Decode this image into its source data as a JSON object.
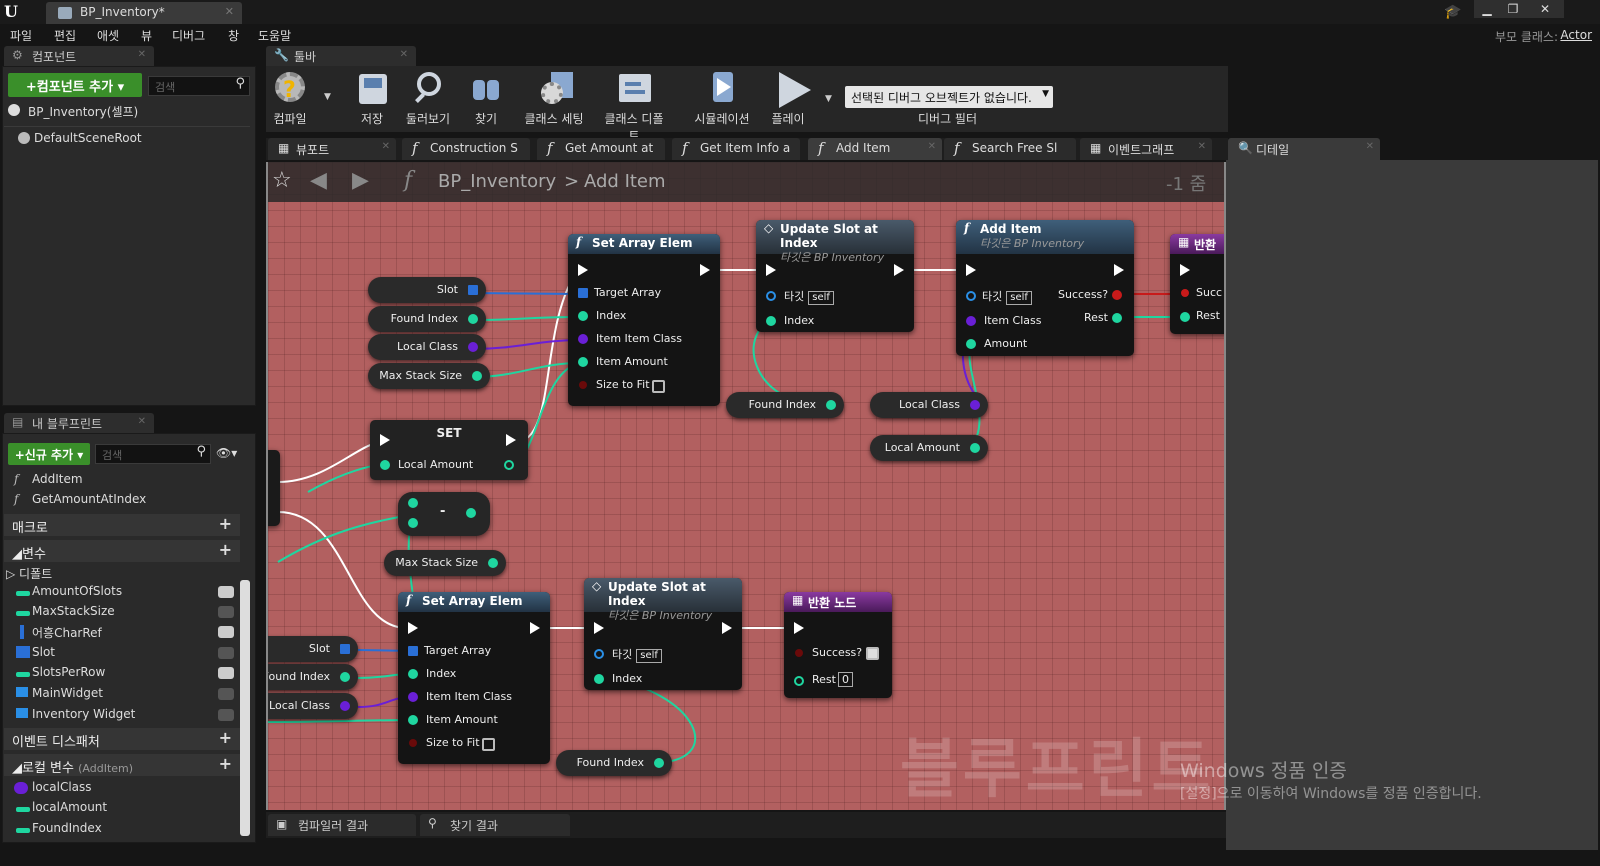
{
  "window": {
    "tab_title": "BP_Inventory*",
    "minimize": "▁",
    "restore": "❐",
    "close": "✕"
  },
  "menu": [
    "파일",
    "편집",
    "애셋",
    "뷰",
    "디버그",
    "창",
    "도움말"
  ],
  "parent_class": {
    "label": "부모 클래스:",
    "value": "Actor"
  },
  "components": {
    "tab": "컴포넌트",
    "add_button": "+컴포넌트 추가 ▾",
    "search_placeholder": "검색",
    "root": "BP_Inventory(셀프)",
    "items": [
      "DefaultSceneRoot"
    ]
  },
  "toolbar": {
    "tab": "툴바",
    "buttons": [
      "컴파일",
      "저장",
      "둘러보기",
      "찾기",
      "클래스 세팅",
      "클래스 디폴트",
      "시뮬레이션",
      "플레이"
    ],
    "debug_select": "선택된 디버그 오브젝트가 없습니다.",
    "debug_filter": "디버그 필터"
  },
  "graph_tabs": [
    "뷰포트",
    "Construction S",
    "Get Amount at",
    "Get Item Info a",
    "Add Item",
    "Search Free Sl",
    "이벤트그래프"
  ],
  "details_tab": "디테일",
  "breadcrumb": {
    "root": "BP_Inventory",
    "sep": ">",
    "current": "Add Item",
    "zoom": "-1 줌"
  },
  "my_blueprint": {
    "tab": "내 블루프린트",
    "add_new": "+신규 추가 ▾",
    "search_placeholder": "검색",
    "functions": [
      "AddItem",
      "GetAmountAtIndex"
    ],
    "macros": "매크로",
    "variables": "변수",
    "default_cat": "디폴트",
    "vars": [
      "AmountOfSlots",
      "MaxStackSize",
      "어흥CharRef",
      "Slot",
      "SlotsPerRow",
      "MainWidget",
      "Inventory Widget"
    ],
    "event_dispatchers": "이벤트 디스패처",
    "local_vars": "로컬 변수",
    "local_scope": "(AddItem)",
    "locals": [
      "localClass",
      "localAmount",
      "FoundIndex"
    ]
  },
  "nodes": {
    "set_array_top": {
      "title": "Set Array Elem",
      "pins": [
        "Target Array",
        "Index",
        "Item Item Class",
        "Item Amount",
        "Size to Fit"
      ]
    },
    "update_top": {
      "title": "Update Slot at Index",
      "sub": "타깃은 BP Inventory",
      "target": "타깃",
      "self": "self",
      "index": "Index"
    },
    "add_item": {
      "title": "Add Item",
      "sub": "타깃은 BP Inventory",
      "target": "타깃",
      "self": "self",
      "item_class": "Item Class",
      "amount": "Amount",
      "success": "Success?",
      "rest": "Rest"
    },
    "return_top": {
      "title": "반환",
      "success": "Succ",
      "rest": "Rest"
    },
    "set_node": {
      "title": "SET",
      "pin": "Local Amount"
    },
    "minus": {
      "op": "-"
    },
    "set_array_bot": {
      "title": "Set Array Elem",
      "pins": [
        "Target Array",
        "Index",
        "Item Item Class",
        "Item Amount",
        "Size to Fit"
      ]
    },
    "update_bot": {
      "title": "Update Slot at Index",
      "sub": "타깃은 BP Inventory",
      "target": "타깃",
      "self": "self",
      "index": "Index"
    },
    "return_bot": {
      "title": "반환 노드",
      "success": "Success?",
      "rest": "Rest",
      "rest_val": "0"
    }
  },
  "vars_graph": {
    "slot": "Slot",
    "found_index": "Found Index",
    "local_class": "Local Class",
    "max_stack": "Max Stack Size",
    "local_amount": "Local Amount"
  },
  "watermark": "블루프린트",
  "windows_activation": {
    "title": "Windows 정품 인증",
    "sub": "[설정]으로 이동하여 Windows를 정품 인증합니다."
  },
  "bottom_tabs": [
    "컴파일러 결과",
    "찾기 결과"
  ],
  "colors": {
    "graph_bg": "#b26060",
    "green_btn": "#3a8f2a",
    "pin_green": "#1fd6a0",
    "pin_purple": "#6a1fd6",
    "pin_blue": "#2a6fd6",
    "pin_red": "#c81a1a"
  }
}
